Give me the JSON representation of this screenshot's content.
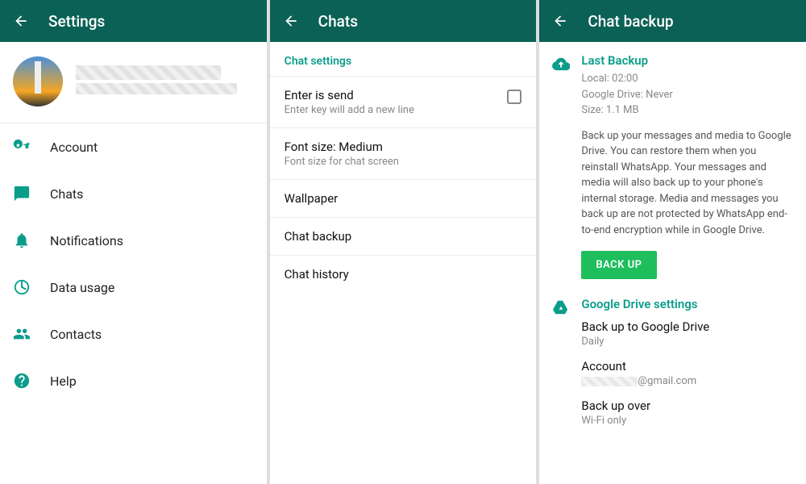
{
  "colors": {
    "primary": "#0b6156",
    "accent": "#0b9d8a",
    "button": "#1ebe5c"
  },
  "panel1": {
    "title": "Settings",
    "items": [
      {
        "icon": "key",
        "label": "Account"
      },
      {
        "icon": "chat",
        "label": "Chats"
      },
      {
        "icon": "bell",
        "label": "Notifications"
      },
      {
        "icon": "data",
        "label": "Data usage"
      },
      {
        "icon": "contacts",
        "label": "Contacts"
      },
      {
        "icon": "help",
        "label": "Help"
      }
    ]
  },
  "panel2": {
    "title": "Chats",
    "section": "Chat settings",
    "items": [
      {
        "main": "Enter is send",
        "sub": "Enter key will add a new line",
        "checkbox": true
      },
      {
        "main": "Font size: Medium",
        "sub": "Font size for chat screen"
      },
      {
        "main": "Wallpaper"
      },
      {
        "main": "Chat backup"
      },
      {
        "main": "Chat history"
      }
    ]
  },
  "panel3": {
    "title": "Chat backup",
    "last_backup": {
      "heading": "Last Backup",
      "local": "Local: 02:00",
      "drive": "Google Drive: Never",
      "size": "Size: 1.1 MB",
      "description": "Back up your messages and media to Google Drive. You can restore them when you reinstall WhatsApp. Your messages and media will also back up to your phone's internal storage. Media and messages you back up are not protected by WhatsApp end-to-end encryption while in Google Drive.",
      "button": "BACK UP"
    },
    "gdrive": {
      "heading": "Google Drive settings",
      "items": [
        {
          "main": "Back up to Google Drive",
          "sub": "Daily"
        },
        {
          "main": "Account",
          "sub_suffix": "@gmail.com",
          "blurred": true
        },
        {
          "main": "Back up over",
          "sub": "Wi-Fi only"
        }
      ]
    }
  }
}
